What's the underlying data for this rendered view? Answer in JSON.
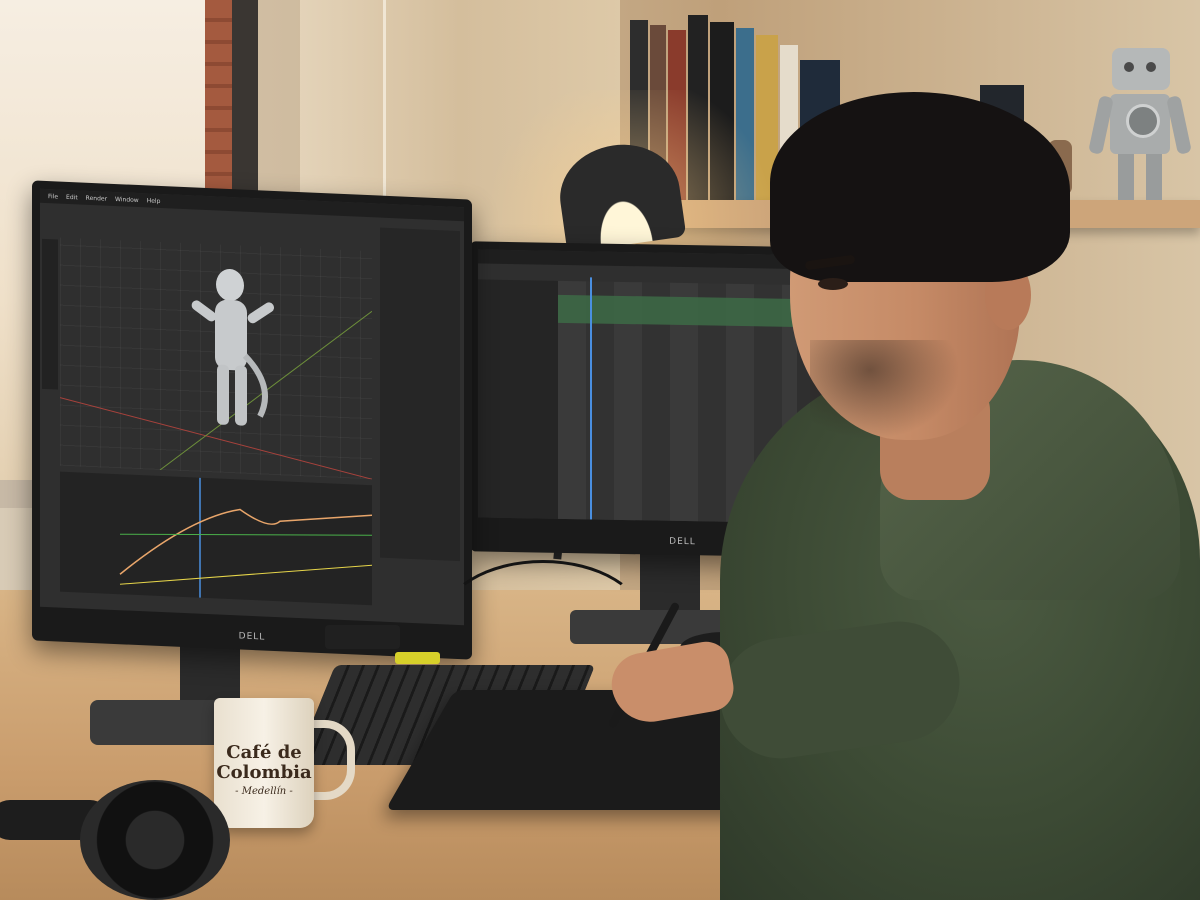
{
  "scene": {
    "left_monitor": {
      "brand": "DELL",
      "menu": [
        "File",
        "Edit",
        "Render",
        "Window",
        "Help"
      ]
    },
    "right_monitor": {
      "brand": "DELL"
    },
    "mug": {
      "line1": "Café de",
      "line2": "Colombia",
      "line3": "- Medellín -"
    },
    "colors": {
      "hoodie": "#3f4c37",
      "desk": "#c99c6c",
      "screen_bg": "#2f2f2f",
      "playhead": "#4a8fe0"
    }
  }
}
